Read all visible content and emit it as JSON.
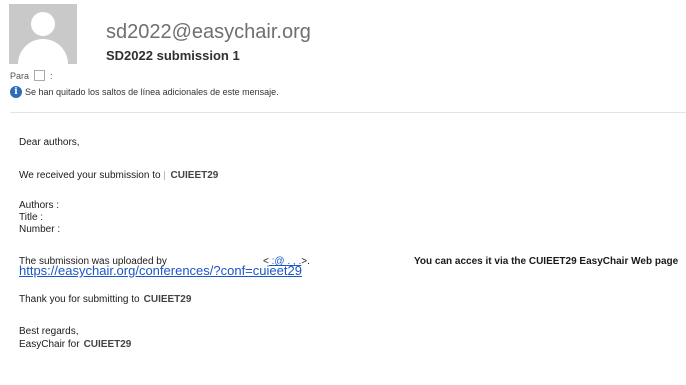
{
  "header": {
    "from": "sd2022@easychair.org",
    "subject": "SD2022  submission 1",
    "to_label": "Para",
    "to_value": ":",
    "info_text": "Se han quitado los saltos de línea adicionales de este mensaje."
  },
  "body": {
    "greeting": "Dear authors,",
    "received": "We received your submission to",
    "conf": "CUIEET29",
    "authors": "Authors :",
    "title": "Title :",
    "number": "Number :",
    "uploaded_by": "The submission was uploaded by",
    "email_open": "<",
    "email_masked": "            :@  .   ,  .",
    "email_close": ">.",
    "access_text": "You can acces it via the CUIEET29 EasyChair Web page",
    "link": "https://easychair.org/conferences/?conf=cuieet29",
    "thanks": "Thank you for submitting to",
    "regards": "Best regards,",
    "signature": "EasyChair for"
  }
}
